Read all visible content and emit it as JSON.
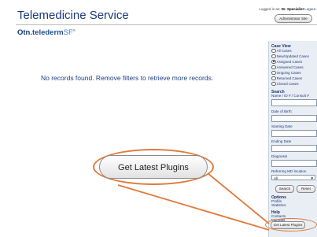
{
  "header": {
    "title": "Telemedicine Service",
    "logged_in_prefix": "Logged in as:",
    "user": "Dr. Specialist",
    "logout": "Logout",
    "admin_button": "Administrator Site"
  },
  "logo": {
    "part_a": "Otn",
    "part_b": ".telederm",
    "part_c": "SF",
    "tm": "®"
  },
  "main": {
    "message": "No records found. Remove filters to retrieve more records."
  },
  "sidebar": {
    "case_view_heading": "Case View",
    "case_view_options": [
      {
        "label": "All Cases",
        "selected": false
      },
      {
        "label": "New/Updated Cases",
        "selected": false
      },
      {
        "label": "Assigned Cases",
        "selected": true
      },
      {
        "label": "Answered Cases",
        "selected": false
      },
      {
        "label": "Ongoing Cases",
        "selected": false
      },
      {
        "label": "Returned Cases",
        "selected": false
      },
      {
        "label": "Closed Cases",
        "selected": false
      }
    ],
    "search_heading": "Search",
    "search_hint": "Name / ID # / Consult #",
    "dob_label": "Date of Birth:",
    "starting_date_label": "Starting Date",
    "ending_date_label": "Ending Date",
    "diagnosis_label": "Diagnosis",
    "referring_label": "Referring MD location",
    "referring_value": "All",
    "search_button": "Search",
    "reset_button": "Reset",
    "options_heading": "Options",
    "options_links": [
      "Profile",
      "Statistics"
    ],
    "help_heading": "Help",
    "help_links": [
      "Contacts",
      "Manuals"
    ],
    "plugins_button": "Get Latest Plugins"
  },
  "callout": {
    "button_label": "Get Latest Plugins",
    "accent_color": "#e07a3c"
  }
}
